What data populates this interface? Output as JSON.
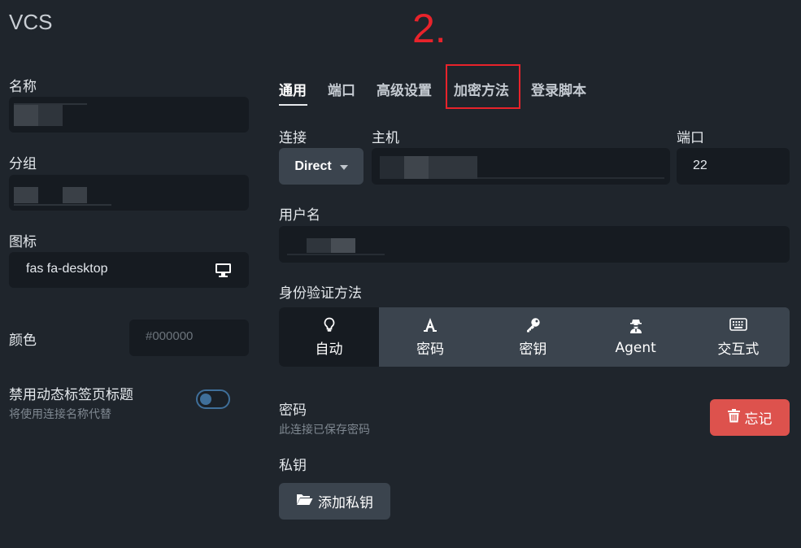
{
  "app_title": "VCS",
  "annotation": "2.",
  "left": {
    "name_label": "名称",
    "group_label": "分组",
    "icon_label": "图标",
    "icon_value": "fas fa-desktop",
    "color_label": "颜色",
    "color_placeholder": "#000000",
    "disable_dynamic_title_label": "禁用动态标签页标题",
    "disable_dynamic_title_desc": "将使用连接名称代替"
  },
  "tabs": [
    {
      "label": "通用",
      "active": true
    },
    {
      "label": "端口",
      "active": false
    },
    {
      "label": "高级设置",
      "active": false
    },
    {
      "label": "加密方法",
      "active": false
    },
    {
      "label": "登录脚本",
      "active": false
    }
  ],
  "connection": {
    "connection_label": "连接",
    "connection_value": "Direct",
    "host_label": "主机",
    "port_label": "端口",
    "port_value": "22",
    "username_label": "用户名"
  },
  "auth": {
    "label": "身份验证方法",
    "options": [
      {
        "label": "自动",
        "icon": "lightbulb-icon",
        "active": true
      },
      {
        "label": "密码",
        "icon": "font-a-icon",
        "active": false
      },
      {
        "label": "密钥",
        "icon": "key-icon",
        "active": false
      },
      {
        "label": "Agent",
        "icon": "user-secret-icon",
        "active": false
      },
      {
        "label": "交互式",
        "icon": "keyboard-icon",
        "active": false
      }
    ]
  },
  "password": {
    "label": "密码",
    "desc": "此连接已保存密码",
    "forget_button": "忘记"
  },
  "private_key": {
    "label": "私钥",
    "add_button": "添加私钥"
  },
  "colors": {
    "background": "#1f252c",
    "field": "#161b21",
    "button": "#3b444e",
    "danger": "#dd524d",
    "annotation": "#e8232b",
    "toggle": "#3f6f9a"
  }
}
